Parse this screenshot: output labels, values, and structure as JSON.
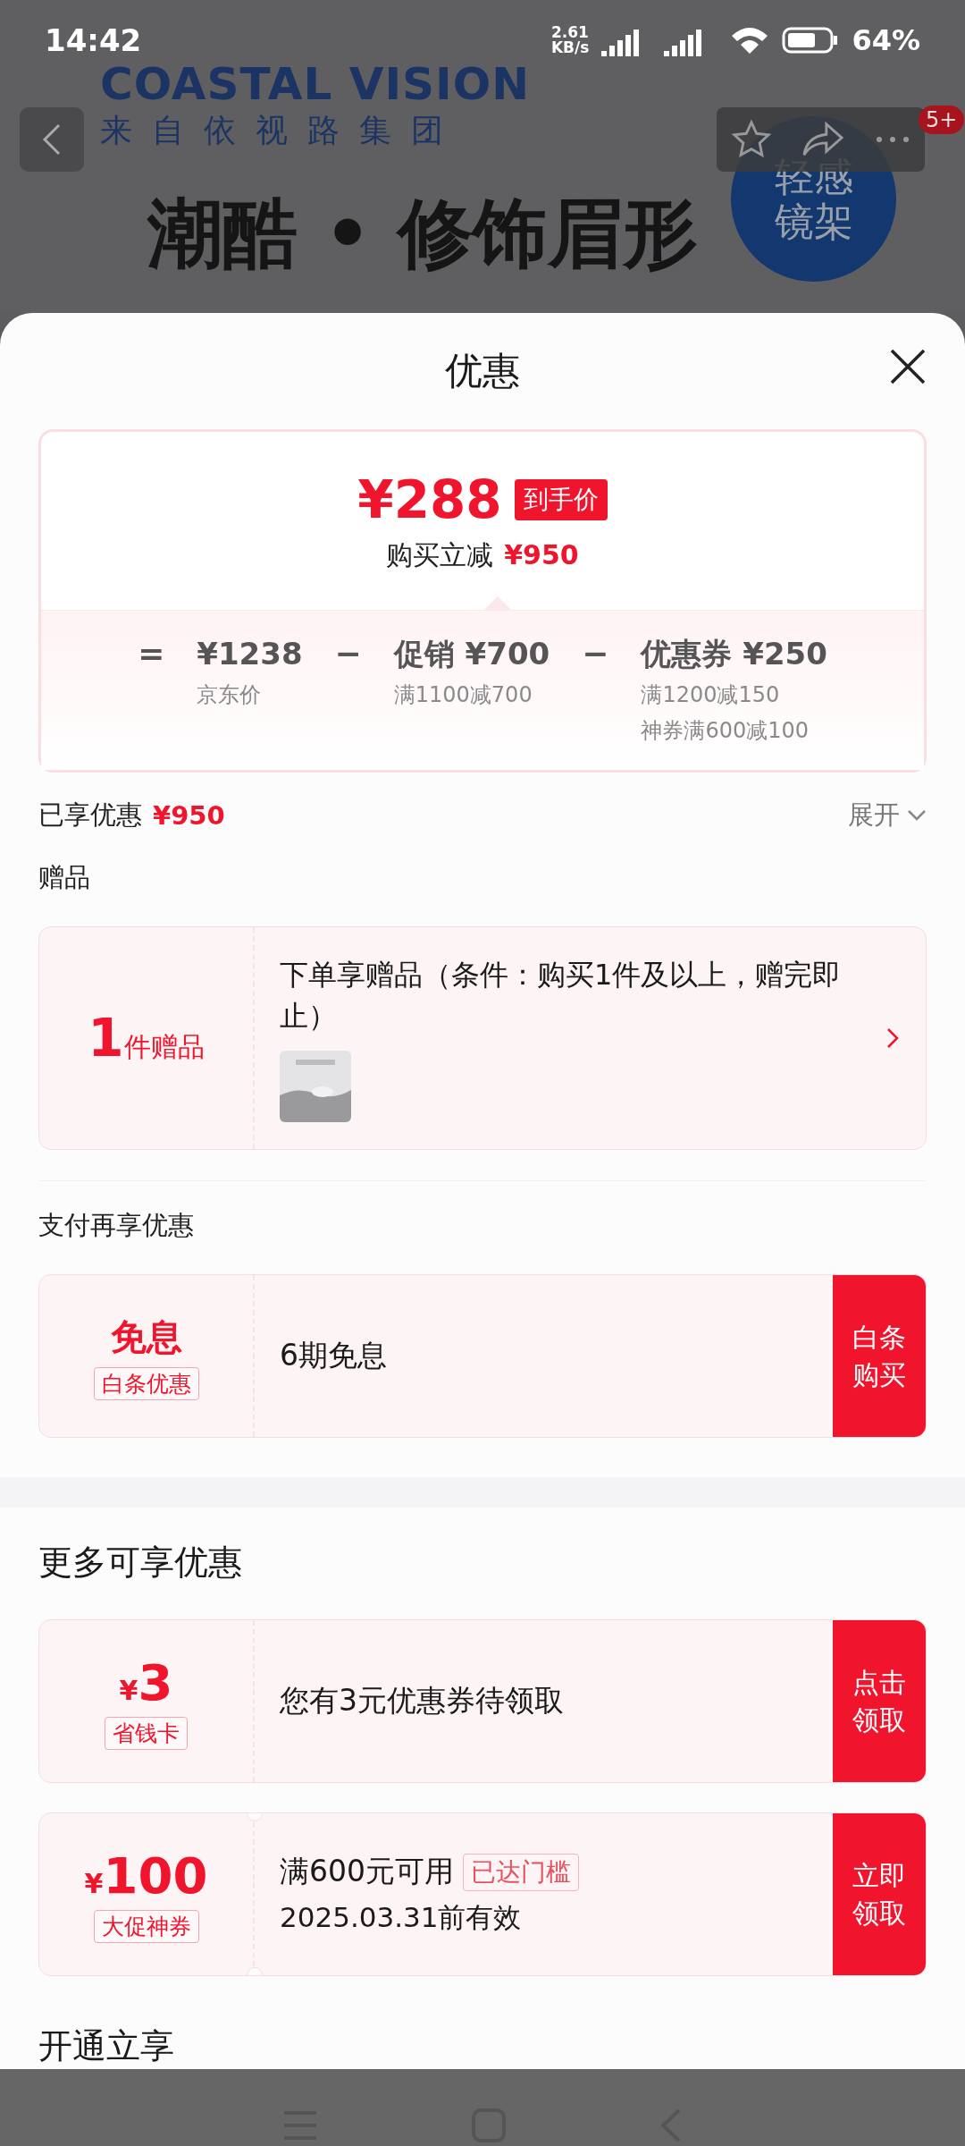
{
  "status_bar": {
    "time": "14:42",
    "net_speed": [
      "2.61",
      "KB/s"
    ],
    "battery": "64%"
  },
  "background_page": {
    "brand": "COASTAL VISION",
    "brand_sub": "来自依视路集团",
    "headline": "潮酷 • 修饰眉形",
    "circle_text": [
      "轻感",
      "镜架"
    ],
    "toolbar_badge": "5+"
  },
  "sheet": {
    "title": "优惠"
  },
  "price_card": {
    "final_price": "¥288",
    "final_tag": "到手价",
    "saving_label": "购买立减",
    "saving_value": "¥950",
    "terms": [
      {
        "op": "=",
        "amount": "¥1238",
        "notes": [
          "京东价"
        ]
      },
      {
        "op": "−",
        "name": "促销",
        "amount": "¥700",
        "notes": [
          "满1100减700"
        ]
      },
      {
        "op": "−",
        "name": "优惠券",
        "amount": "¥250",
        "notes": [
          "满1200减150",
          "神券满600减100"
        ]
      }
    ]
  },
  "enjoyed": {
    "label": "已享优惠",
    "value": "¥950",
    "expand": "展开"
  },
  "gift": {
    "heading": "赠品",
    "count": "1",
    "unit": "件赠品",
    "text": "下单享赠品（条件：购买1件及以上，赠完即止）"
  },
  "payment": {
    "heading": "支付再享优惠",
    "card": {
      "kind": "label",
      "main": "免息",
      "tag": "白条优惠",
      "text": "6期免息",
      "action": "白条购买"
    }
  },
  "more": {
    "heading": "更多可享优惠",
    "coupons": [
      {
        "kind": "amount",
        "currency": "¥",
        "amount": "3",
        "tag": "省钱卡",
        "text": "您有3元优惠券待领取",
        "action": "点击领取"
      },
      {
        "kind": "ticket",
        "currency": "¥",
        "amount": "100",
        "tag": "大促神券",
        "text": "满600元可用",
        "badge": "已达门槛",
        "sub": "2025.03.31前有效",
        "action": "立即领取"
      }
    ]
  },
  "next_heading": "开通立享"
}
